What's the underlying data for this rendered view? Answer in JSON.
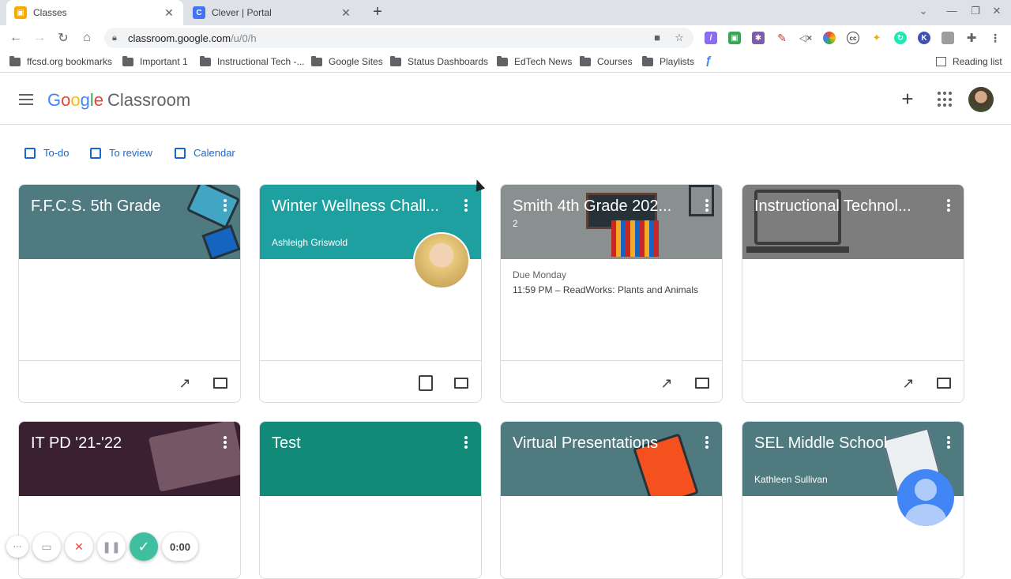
{
  "browser": {
    "tabs": [
      {
        "title": "Classes",
        "favicon": "classroom-favicon",
        "active": true
      },
      {
        "title": "Clever | Portal",
        "favicon": "clever-favicon",
        "active": false
      }
    ],
    "url_host": "classroom.google.com",
    "url_path": "/u/0/h",
    "reading_list": "Reading list",
    "bookmarks": [
      "ffcsd.org bookmarks",
      "Important 1",
      "Instructional Tech -...",
      "Google Sites",
      "Status Dashboards",
      "EdTech News",
      "Courses",
      "Playlists"
    ]
  },
  "app": {
    "logo_google": [
      "G",
      "o",
      "o",
      "g",
      "l",
      "e"
    ],
    "logo_product": "Classroom"
  },
  "quick_links": [
    "To-do",
    "To review",
    "Calendar"
  ],
  "cards": [
    {
      "name": "F.F.C.S. 5th Grade",
      "subtitle": "",
      "color": "#4f7a80"
    },
    {
      "name": "Winter Wellness Chall...",
      "subtitle": "Ashleigh Griswold",
      "color": "#1ea0a0"
    },
    {
      "name": "Smith 4th Grade 202...",
      "subtitle": "2",
      "color": "#8a8f8f",
      "due_label": "Due Monday",
      "due_item": "11:59 PM – ReadWorks: Plants and Animals"
    },
    {
      "name": "Instructional Technol...",
      "subtitle": "",
      "color": "#7d7d7d"
    },
    {
      "name": "IT PD '21-'22",
      "subtitle": "",
      "color": "#3a2030"
    },
    {
      "name": "Test",
      "subtitle": "",
      "color": "#128a7a"
    },
    {
      "name": "Virtual Presentations",
      "subtitle": "",
      "color": "#4f7a80"
    },
    {
      "name": "SEL Middle School",
      "subtitle": "Kathleen Sullivan",
      "color": "#4f7a80"
    }
  ],
  "recorder": {
    "time": "0:00"
  }
}
